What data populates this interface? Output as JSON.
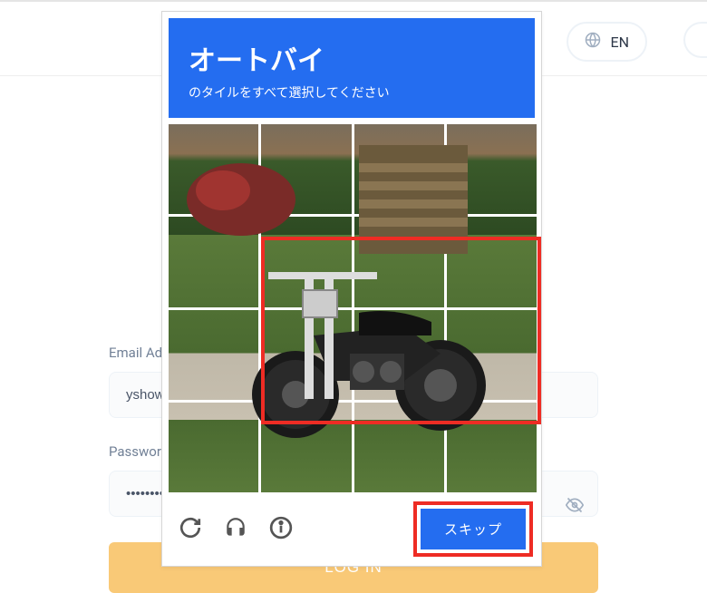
{
  "header": {
    "language": "EN"
  },
  "login": {
    "email_label": "Email Ad",
    "email_value": "yshow",
    "password_label": "Passwor",
    "password_value": "••••••••••",
    "login_button": "LOG IN"
  },
  "captcha": {
    "title": "オートバイ",
    "subtitle": "のタイルをすべて選択してください",
    "skip_label": "スキップ",
    "grid_size": 4,
    "highlighted_tiles": [
      5,
      6,
      7,
      9,
      10,
      11
    ],
    "icons": {
      "reload": "reload-icon",
      "audio": "headphone-icon",
      "info": "info-icon"
    }
  },
  "colors": {
    "primary_blue": "#246df0",
    "highlight_red": "#ee2c24",
    "login_amber": "#f9c977"
  }
}
